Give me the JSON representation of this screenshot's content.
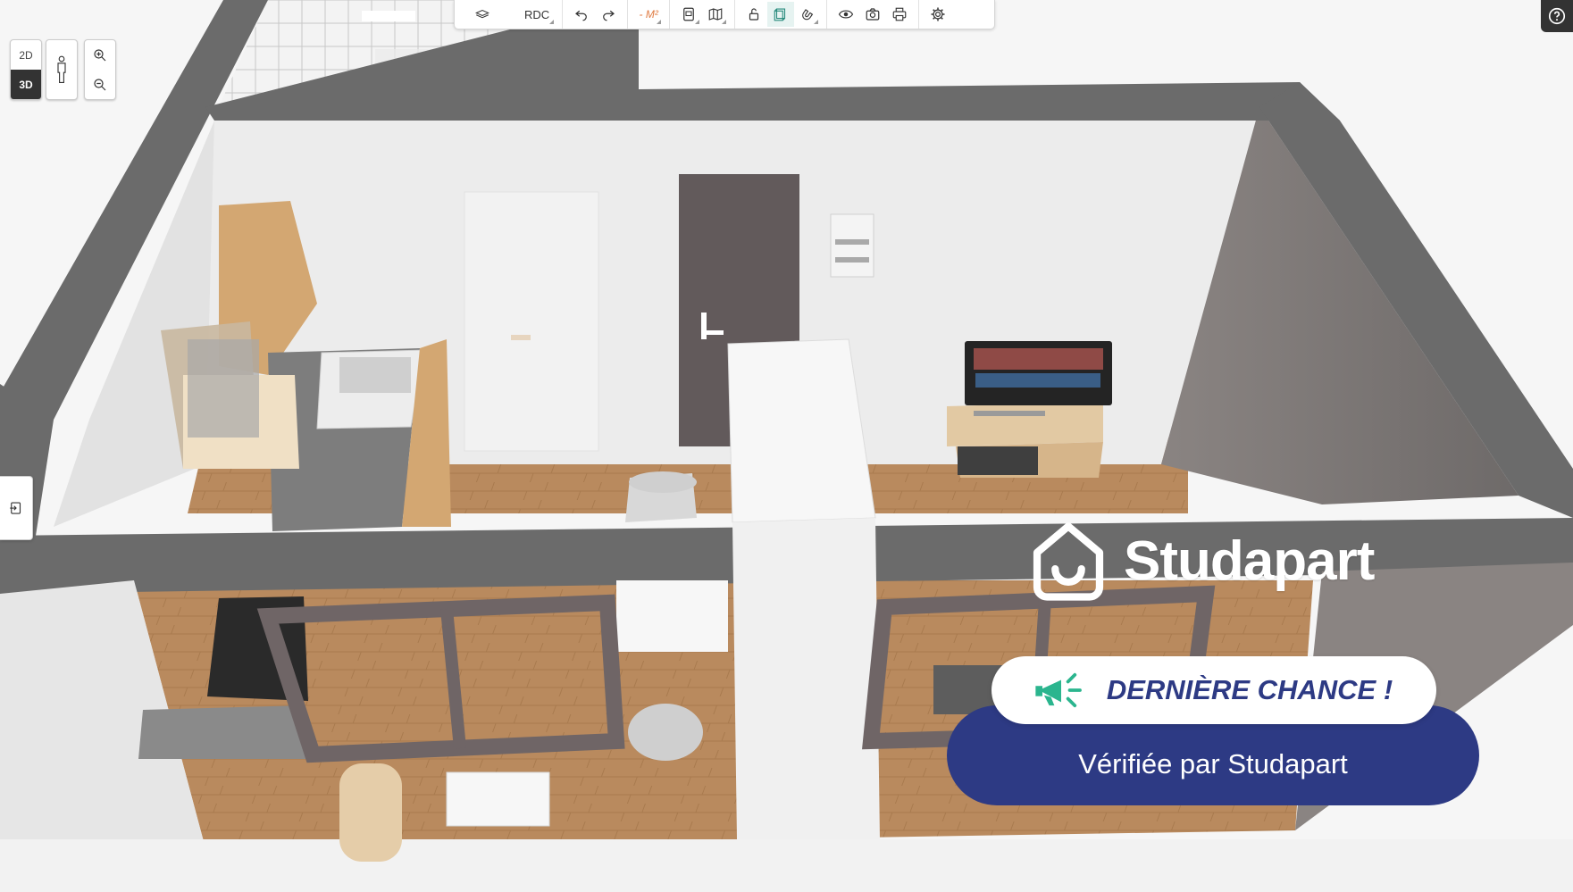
{
  "toolbar": {
    "level_label": "RDC",
    "m2_label": "- M²"
  },
  "view": {
    "btn_2d": "2D",
    "btn_3d": "3D",
    "active": "3D"
  },
  "overlay": {
    "brand_name": "Studapart",
    "banner_text": "DERNIÈRE CHANCE !",
    "verified_text": "Vérifiée par Studapart"
  },
  "colors": {
    "brand_navy": "#2d3a84",
    "accent_green": "#2bb58e",
    "wall_gray": "#6b6b6b",
    "floor_wood": "#b98a5e"
  }
}
